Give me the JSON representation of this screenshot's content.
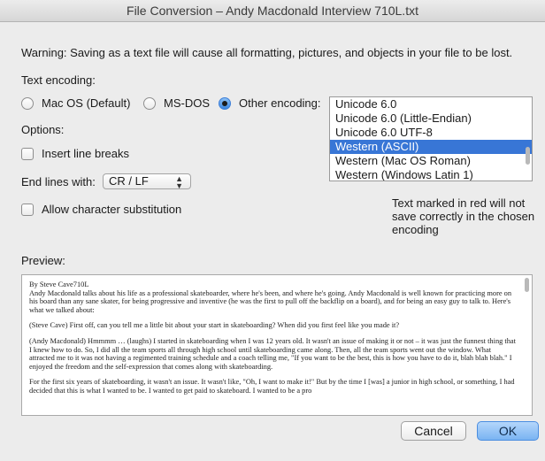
{
  "window": {
    "title": "File Conversion – Andy Macdonald Interview 710L.txt"
  },
  "warning": "Warning: Saving as a text file will cause all formatting, pictures, and objects in your file to be lost.",
  "encoding": {
    "label": "Text encoding:",
    "radios": [
      {
        "label": "Mac OS (Default)",
        "selected": false
      },
      {
        "label": "MS-DOS",
        "selected": false
      },
      {
        "label": "Other encoding:",
        "selected": true
      }
    ],
    "list": [
      "Unicode 6.0",
      "Unicode 6.0 (Little-Endian)",
      "Unicode 6.0 UTF-8",
      "Western (ASCII)",
      "Western (Mac OS Roman)",
      "Western (Windows Latin 1)"
    ],
    "selected_index": 3
  },
  "options": {
    "label": "Options:",
    "insert_line_breaks": "Insert line breaks",
    "end_lines_label": "End lines with:",
    "end_lines_value": "CR / LF",
    "allow_substitution": "Allow character substitution",
    "red_note": "Text marked in red will not save correctly in the chosen encoding"
  },
  "preview": {
    "label": "Preview:",
    "paragraphs": [
      "By Steve Cave710L\nAndy Macdonald talks about his life as a professional skateboarder, where he's been, and where he's going. Andy Macdonald is well known for practicing more on his board than any sane skater, for being progressive and inventive (he was the first to pull off the backflip on a board), and for being an easy guy to talk to. Here's what we talked about:",
      "(Steve Cave) First off, can you tell me a little bit about your start in skateboarding?  When did you first feel like you made it?",
      "(Andy Macdonald) Hmmmm … (laughs) I started in skateboarding when I was 12 years old.  It wasn't an issue of making it or not – it was just the funnest thing that I knew how to do. So, I did all the team sports all through high school until skateboarding came along. Then, all the team sports went out the window.  What attracted me to it was not having a regimented training schedule and a coach telling me, \"If you want to be the best, this is how you have to do it, blah blah blah.\" I enjoyed the freedom and the self-expression that comes along with skateboarding.",
      "For the first six years of skateboarding, it wasn't an issue.  It wasn't like, \"Oh, I want to make it!\" But by the time I [was] a junior in high school, or something, I had decided that this is what I wanted to be.  I wanted to get paid to skateboard.  I wanted to be a pro"
    ]
  },
  "buttons": {
    "cancel": "Cancel",
    "ok": "OK"
  }
}
